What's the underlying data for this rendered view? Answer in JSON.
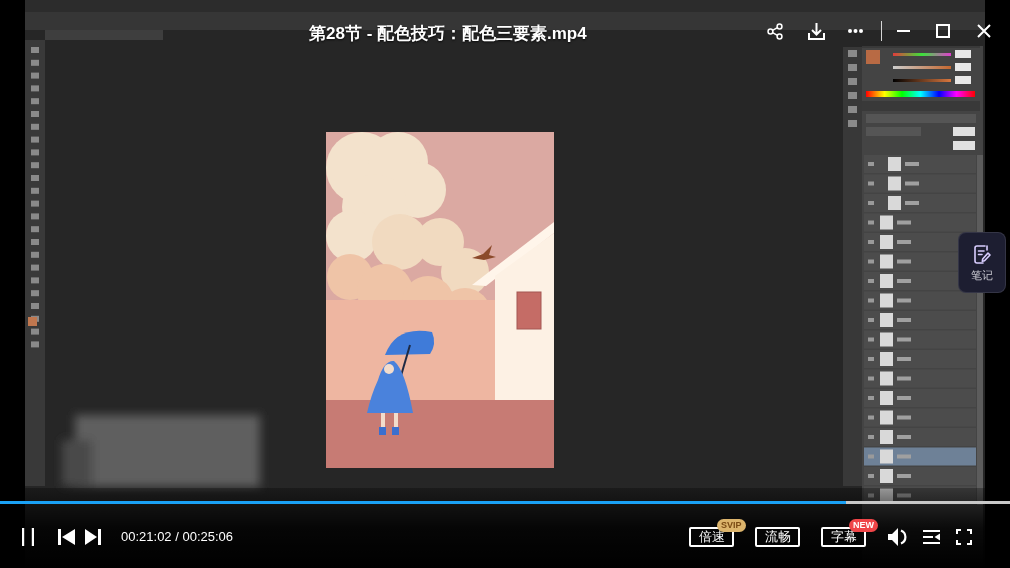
{
  "video": {
    "title": "第28节 - 配色技巧：配色三要素.mp4"
  },
  "notes_button": {
    "label": "笔记"
  },
  "player": {
    "playing": true,
    "progress": {
      "level": 0.838
    },
    "time": "00:21:02 / 00:25:06",
    "speed_button": {
      "label": "倍速",
      "badge": {
        "text": "SVIP",
        "color": "#dcb46c"
      }
    },
    "quality_button": {
      "label": "流畅"
    },
    "subtitle_button": {
      "label": "字幕",
      "badge": {
        "text": "NEW",
        "color": "#ef4548"
      }
    }
  }
}
